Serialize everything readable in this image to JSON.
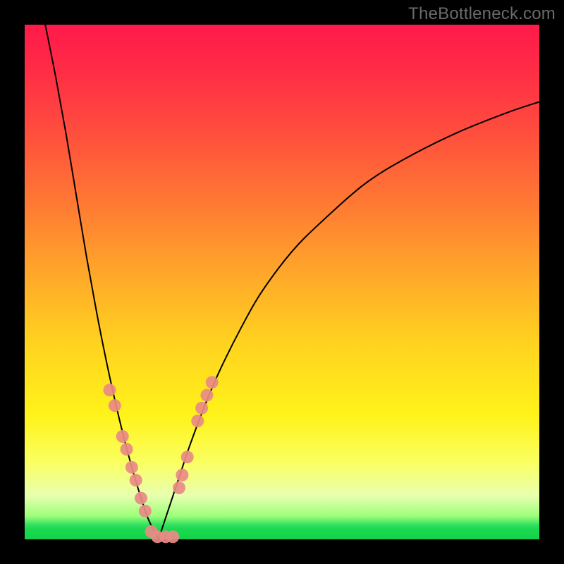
{
  "watermark": "TheBottleneck.com",
  "chart_data": {
    "type": "line",
    "title": "",
    "xlabel": "",
    "ylabel": "",
    "xlim": [
      0,
      100
    ],
    "ylim": [
      0,
      100
    ],
    "grid": false,
    "legend": false,
    "curve_note": "Two strictly monotone black curves: left branch descends steeply from top-left to a minimum near x≈26 at y≈0, right branch ascends from the same minimum toward top-right with decreasing slope.",
    "series": [
      {
        "name": "left_branch",
        "x": [
          4,
          6,
          8,
          10,
          12,
          14,
          16,
          18,
          20,
          22,
          24,
          26
        ],
        "y": [
          100,
          90,
          79,
          67,
          55,
          44,
          34,
          25,
          17,
          10,
          4,
          0
        ]
      },
      {
        "name": "right_branch",
        "x": [
          26,
          28,
          30,
          32,
          35,
          38,
          42,
          46,
          52,
          58,
          66,
          74,
          84,
          94,
          100
        ],
        "y": [
          0,
          6,
          12,
          18,
          26,
          33,
          41,
          48,
          56,
          62,
          69,
          74,
          79,
          83,
          85
        ]
      }
    ],
    "markers": {
      "color": "#e98a86",
      "radius_px": 9,
      "note": "Pink circular markers clustered along the lower stretch of both branches and along the flat bottom.",
      "points": [
        {
          "x": 16.5,
          "y": 29
        },
        {
          "x": 17.5,
          "y": 26
        },
        {
          "x": 19.0,
          "y": 20
        },
        {
          "x": 19.8,
          "y": 17.5
        },
        {
          "x": 20.8,
          "y": 14
        },
        {
          "x": 21.6,
          "y": 11.5
        },
        {
          "x": 22.6,
          "y": 8
        },
        {
          "x": 23.4,
          "y": 5.5
        },
        {
          "x": 24.6,
          "y": 1.5
        },
        {
          "x": 25.8,
          "y": 0.5
        },
        {
          "x": 27.4,
          "y": 0.5
        },
        {
          "x": 28.8,
          "y": 0.5
        },
        {
          "x": 30.0,
          "y": 10
        },
        {
          "x": 30.6,
          "y": 12.5
        },
        {
          "x": 31.6,
          "y": 16
        },
        {
          "x": 33.6,
          "y": 23
        },
        {
          "x": 34.4,
          "y": 25.5
        },
        {
          "x": 35.4,
          "y": 28
        },
        {
          "x": 36.4,
          "y": 30.5
        }
      ]
    }
  }
}
